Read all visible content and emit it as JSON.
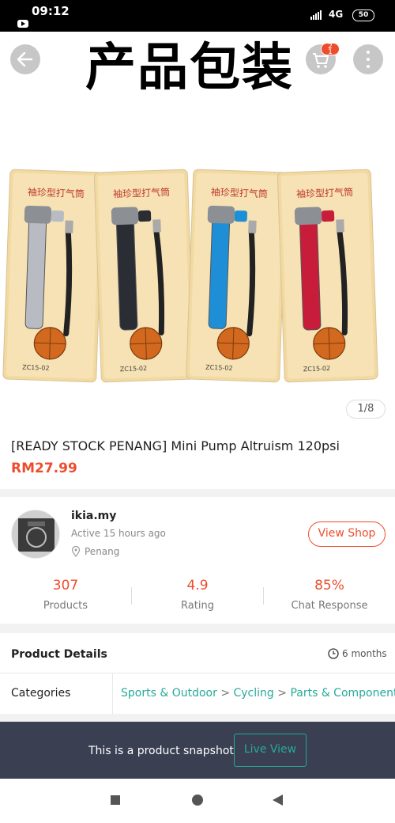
{
  "status_bar": {
    "time": "09:12",
    "network": "4G",
    "battery": "50"
  },
  "header": {
    "banner_text": "产品包装",
    "cart_badge": "2\n1",
    "back_icon": "arrow-left-icon",
    "cart_icon": "cart-icon",
    "more_icon": "more-vertical-icon"
  },
  "gallery": {
    "page_indicator": "1/8",
    "package_label": "袖珍型打气筒",
    "model_label": "ZC15-02",
    "pump_colors": [
      "#b8bcc2",
      "#2a2d33",
      "#1e8fd6",
      "#c81d3a"
    ]
  },
  "product": {
    "name": "[READY STOCK PENANG] Mini Pump Altruism 120psi",
    "price": "RM27.99"
  },
  "shop": {
    "name": "ikia.my",
    "active": "Active 15 hours ago",
    "location": "Penang",
    "view_shop_label": "View Shop",
    "stats": [
      {
        "value": "307",
        "label": "Products"
      },
      {
        "value": "4.9",
        "label": "Rating"
      },
      {
        "value": "85%",
        "label": "Chat Response"
      }
    ]
  },
  "details": {
    "title": "Product Details",
    "age": "6 months",
    "categories_label": "Categories",
    "categories": [
      "Sports & Outdoor",
      "Cycling",
      "Parts & Components"
    ],
    "category_separator": ">"
  },
  "snapshot": {
    "text": "This is a product snapshot",
    "live_view_label": "Live View"
  },
  "colors": {
    "accent": "#ee4d2d",
    "teal": "#26aa99",
    "banner_bg": "#3a3f52"
  }
}
